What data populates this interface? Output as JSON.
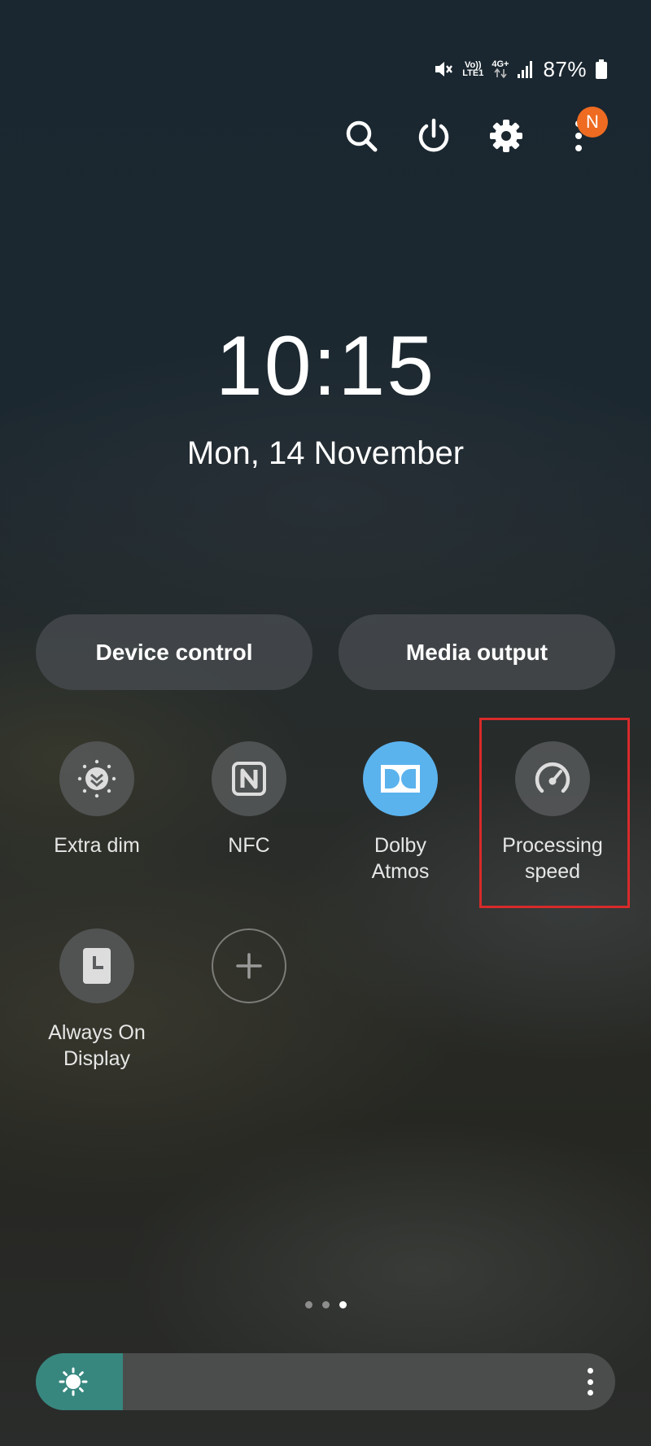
{
  "status_bar": {
    "volte": "Vo))",
    "lte": "LTE1",
    "network": "4G+",
    "battery": "87%"
  },
  "header": {
    "notification_badge": "N"
  },
  "clock": {
    "time": "10:15",
    "date": "Mon, 14 November"
  },
  "buttons": {
    "device_control": "Device control",
    "media_output": "Media output"
  },
  "tiles": [
    {
      "label": "Extra dim",
      "icon": "extra-dim-icon",
      "active": false
    },
    {
      "label": "NFC",
      "icon": "nfc-icon",
      "active": false
    },
    {
      "label": "Dolby Atmos",
      "icon": "dolby-icon",
      "active": true
    },
    {
      "label": "Processing speed",
      "icon": "speedometer-icon",
      "active": false
    },
    {
      "label": "Always On Display",
      "icon": "clock-icon",
      "active": false
    }
  ],
  "pager": {
    "pages": 3,
    "current": 3
  },
  "brightness": {
    "level": 0.15
  },
  "colors": {
    "accent_active": "#5bb3ee",
    "brightness_fill": "#37877f",
    "badge": "#ee6b21",
    "highlight": "#d82a2a"
  }
}
